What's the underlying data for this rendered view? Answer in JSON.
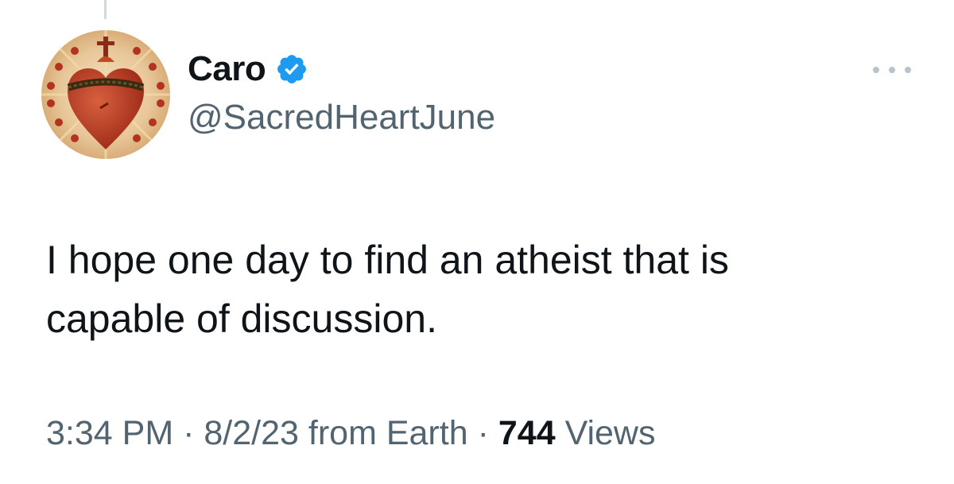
{
  "tweet": {
    "display_name": "Caro",
    "handle": "@SacredHeartJune",
    "verified": true,
    "text": "I hope one day to find an atheist that is\ncapable of discussion.",
    "time": "3:34 PM",
    "separator": "·",
    "date": "8/2/23",
    "source": "from Earth",
    "views_count": "744",
    "views_label": "Views"
  },
  "icons": {
    "avatar": "sacred-heart-avatar",
    "verified": "verified-badge-icon",
    "more": "more-options-icon"
  },
  "colors": {
    "verified_blue": "#1d9bf0",
    "text_primary": "#0f1419",
    "text_secondary": "#536471"
  }
}
